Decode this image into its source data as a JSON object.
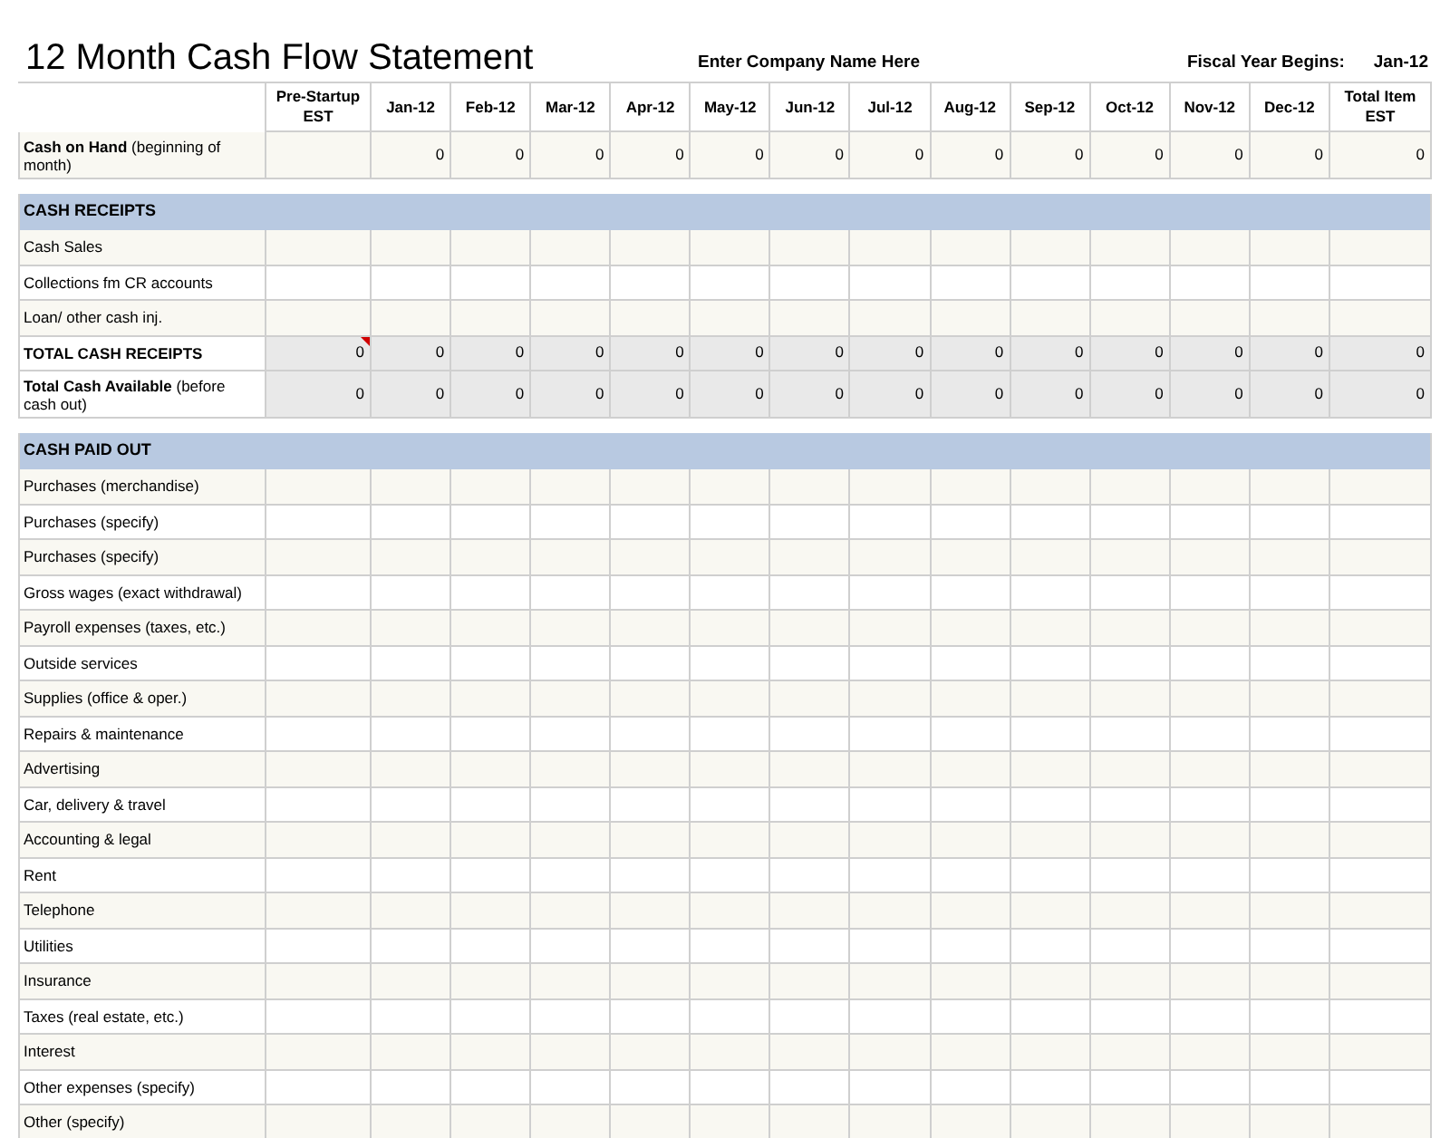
{
  "title": "12 Month Cash Flow Statement",
  "company_name": "Enter Company Name Here",
  "fiscal_year": {
    "label": "Fiscal Year Begins:",
    "value": "Jan-12"
  },
  "columns": [
    "Pre-Startup EST",
    "Jan-12",
    "Feb-12",
    "Mar-12",
    "Apr-12",
    "May-12",
    "Jun-12",
    "Jul-12",
    "Aug-12",
    "Sep-12",
    "Oct-12",
    "Nov-12",
    "Dec-12",
    "Total Item EST"
  ],
  "cash_on_hand": {
    "label": "**Cash on Hand** (beginning of month)",
    "values": [
      "0",
      "0",
      "0",
      "0",
      "0",
      "0",
      "0",
      "0",
      "0",
      "0",
      "0",
      "0",
      "0"
    ]
  },
  "sections": [
    {
      "title": "CASH RECEIPTS",
      "rows": [
        {
          "label": "Cash Sales",
          "kind": "input",
          "commented": false
        },
        {
          "label": "Collections fm CR accounts",
          "kind": "input",
          "commented": false
        },
        {
          "label": "Loan/ other cash inj.",
          "kind": "input",
          "commented": false
        },
        {
          "label": "**TOTAL CASH RECEIPTS**",
          "kind": "total",
          "commented": true,
          "values": [
            "0",
            "0",
            "0",
            "0",
            "0",
            "0",
            "0",
            "0",
            "0",
            "0",
            "0",
            "0",
            "0",
            "0"
          ]
        },
        {
          "label": "**Total Cash Available** (before cash out)",
          "kind": "total",
          "commented": false,
          "values": [
            "0",
            "0",
            "0",
            "0",
            "0",
            "0",
            "0",
            "0",
            "0",
            "0",
            "0",
            "0",
            "0",
            "0"
          ]
        }
      ]
    },
    {
      "title": "CASH PAID OUT",
      "rows": [
        {
          "label": "Purchases (merchandise)",
          "kind": "input",
          "commented": false
        },
        {
          "label": "Purchases (specify)",
          "kind": "input",
          "commented": false
        },
        {
          "label": "Purchases (specify)",
          "kind": "input",
          "commented": false
        },
        {
          "label": "Gross wages (exact withdrawal)",
          "kind": "input",
          "commented": false
        },
        {
          "label": "Payroll expenses (taxes, etc.)",
          "kind": "input",
          "commented": false
        },
        {
          "label": "Outside services",
          "kind": "input",
          "commented": false
        },
        {
          "label": "Supplies (office & oper.)",
          "kind": "input",
          "commented": false
        },
        {
          "label": "Repairs & maintenance",
          "kind": "input",
          "commented": false
        },
        {
          "label": "Advertising",
          "kind": "input",
          "commented": false
        },
        {
          "label": "Car, delivery & travel",
          "kind": "input",
          "commented": false
        },
        {
          "label": "Accounting & legal",
          "kind": "input",
          "commented": false
        },
        {
          "label": "Rent",
          "kind": "input",
          "commented": false
        },
        {
          "label": "Telephone",
          "kind": "input",
          "commented": false
        },
        {
          "label": "Utilities",
          "kind": "input",
          "commented": false
        },
        {
          "label": "Insurance",
          "kind": "input",
          "commented": false
        },
        {
          "label": "Taxes (real estate, etc.)",
          "kind": "input",
          "commented": false
        },
        {
          "label": "Interest",
          "kind": "input",
          "commented": false
        },
        {
          "label": "Other expenses (specify)",
          "kind": "input",
          "commented": false
        },
        {
          "label": "Other (specify)",
          "kind": "input",
          "commented": false
        }
      ]
    }
  ]
}
